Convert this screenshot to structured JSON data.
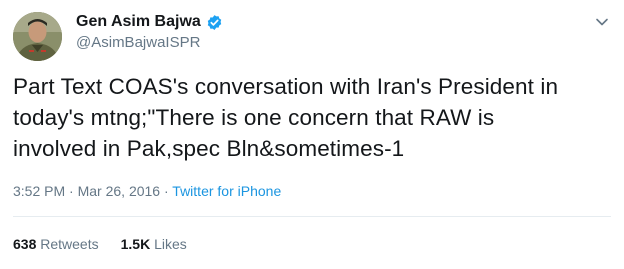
{
  "user": {
    "display_name": "Gen Asim Bajwa",
    "handle": "@AsimBajwaISPR",
    "verified": true
  },
  "tweet": {
    "text_lines": [
      "Part Text COAS's conversation with Iran's President in",
      "today's mtng;\"There is one concern that RAW is",
      "involved in Pak,spec Bln&sometimes-1"
    ],
    "time": "3:52 PM",
    "date": "Mar 26, 2016",
    "separator": "·",
    "source": "Twitter for iPhone"
  },
  "stats": {
    "retweets_count": "638",
    "retweets_label": "Retweets",
    "likes_count": "1.5K",
    "likes_label": "Likes"
  },
  "icons": {
    "verified": "verified-badge-icon",
    "menu": "chevron-down-icon"
  },
  "colors": {
    "accent": "#1b95e0",
    "text": "#14171a",
    "secondary": "#657786"
  }
}
